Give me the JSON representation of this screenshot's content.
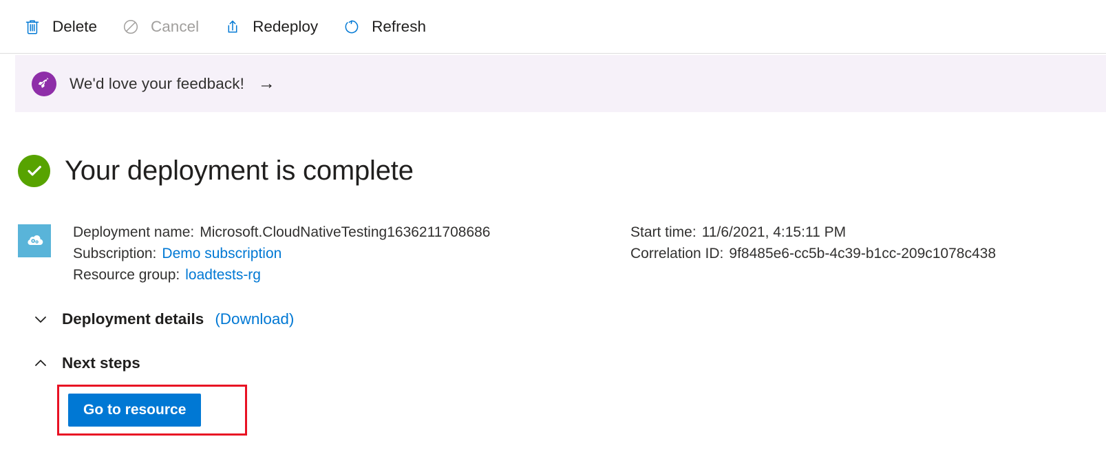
{
  "toolbar": {
    "buttons": [
      {
        "label": "Delete",
        "icon": "trash-icon",
        "enabled": true
      },
      {
        "label": "Cancel",
        "icon": "cancel-icon",
        "enabled": false
      },
      {
        "label": "Redeploy",
        "icon": "upload-icon",
        "enabled": true
      },
      {
        "label": "Refresh",
        "icon": "refresh-icon",
        "enabled": true
      }
    ]
  },
  "feedback_banner": {
    "icon": "rocket-icon",
    "text": "We'd love your feedback!",
    "arrow": "→",
    "background_color": "#f6f1f9",
    "icon_color": "#8e2ea8"
  },
  "status": {
    "icon": "success-check-icon",
    "icon_color": "#57a300",
    "title": "Your deployment is complete"
  },
  "deployment_info": {
    "icon": "deployment-cloud-gears-icon",
    "icon_background": "#59b4d9",
    "left": [
      {
        "label": "Deployment name:",
        "value": "Microsoft.CloudNativeTesting1636211708686",
        "is_link": false
      },
      {
        "label": "Subscription:",
        "value": "Demo subscription",
        "is_link": true
      },
      {
        "label": "Resource group:",
        "value": "loadtests-rg",
        "is_link": true
      }
    ],
    "right": [
      {
        "label": "Start time:",
        "value": "11/6/2021, 4:15:11 PM",
        "is_link": false
      },
      {
        "label": "Correlation ID:",
        "value": "9f8485e6-cc5b-4c39-b1cc-209c1078c438",
        "is_link": false
      }
    ]
  },
  "sections": {
    "deployment_details": {
      "title": "Deployment details",
      "link": "(Download)",
      "chevron": "chevron-down-icon",
      "expanded": false
    },
    "next_steps": {
      "title": "Next steps",
      "chevron": "chevron-up-icon",
      "expanded": true,
      "action_label": "Go to resource",
      "action_color": "#0078d4",
      "highlight_color": "#e81123"
    }
  }
}
